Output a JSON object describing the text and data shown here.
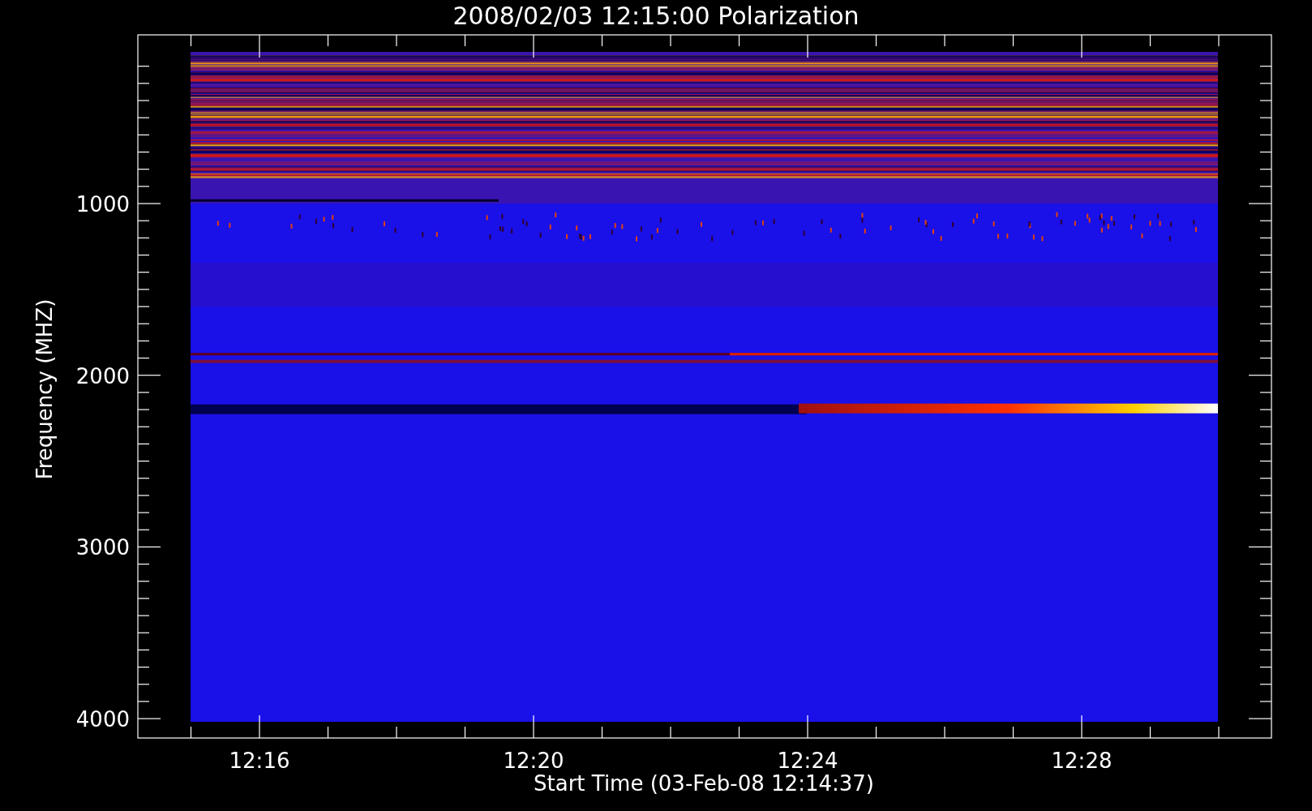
{
  "title": "2008/02/03 12:15:00 Polarization",
  "y_axis": {
    "label": "Frequency (MHZ)",
    "ticks": [
      "1000",
      "2000",
      "3000",
      "4000"
    ]
  },
  "x_axis": {
    "label": "Start Time (03-Feb-08 12:14:37)",
    "ticks": [
      "12:16",
      "12:20",
      "12:24",
      "12:28"
    ]
  }
}
